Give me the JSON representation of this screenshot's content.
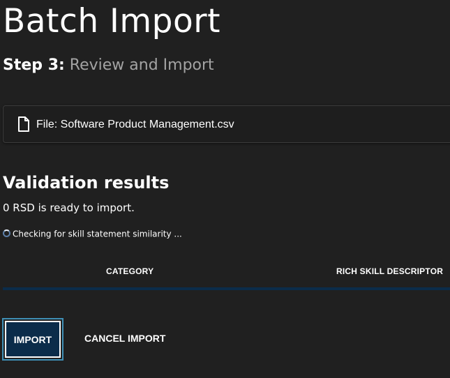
{
  "page": {
    "title": "Batch Import"
  },
  "step": {
    "label": "Step 3:",
    "name": "Review and Import"
  },
  "file_card": {
    "icon": "file-icon",
    "text": "File: Software Product Management.csv"
  },
  "validation": {
    "title": "Validation results",
    "ready_text": "0 RSD is ready to import.",
    "checking_icon": "spinner-icon",
    "checking_text": "Checking for skill statement similarity ..."
  },
  "table": {
    "columns": [
      "CATEGORY",
      "RICH SKILL DESCRIPTOR"
    ],
    "rule_color": "#0b2c4a"
  },
  "actions": {
    "import_label": "IMPORT",
    "cancel_label": "CANCEL IMPORT"
  },
  "colors": {
    "background": "#202020",
    "primary_button": "#0b2c4a",
    "focus_ring": "#3f8fb5",
    "muted_text": "#a3a3a3"
  }
}
